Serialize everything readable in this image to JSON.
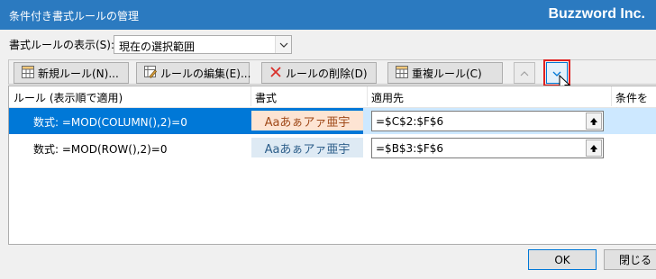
{
  "window": {
    "title": "条件付き書式ルールの管理",
    "brand": "Buzzword Inc."
  },
  "show_rules": {
    "label": "書式ルールの表示(S):",
    "value": "現在の選択範囲"
  },
  "toolbar": {
    "new_rule": "新規ルール(N)...",
    "edit_rule": "ルールの編集(E)...",
    "delete_rule": "ルールの削除(D)",
    "duplicate_rule": "重複ルール(C)"
  },
  "columns": [
    "ルール (表示順で適用)",
    "書式",
    "適用先",
    "条件を満"
  ],
  "rules": [
    {
      "rule": "数式: =MOD(COLUMN(),2)=0",
      "format_sample": "Aaあぁアァ亜宇",
      "applies_to": "=$C$2:$F$6"
    },
    {
      "rule": "数式: =MOD(ROW(),2)=0",
      "format_sample": "Aaあぁアァ亜宇",
      "applies_to": "=$B$3:$F$6"
    }
  ],
  "buttons": {
    "ok": "OK",
    "close": "閉じる"
  },
  "colors": {
    "titlebar": "#2b7ac0",
    "selection": "#0078d7",
    "highlight": "#e02020"
  },
  "icons": [
    "new-rule-icon",
    "edit-rule-icon",
    "delete-icon",
    "duplicate-icon",
    "move-up-icon",
    "move-down-icon",
    "range-picker-icon",
    "dropdown-arrow-icon",
    "mouse-cursor-icon"
  ]
}
